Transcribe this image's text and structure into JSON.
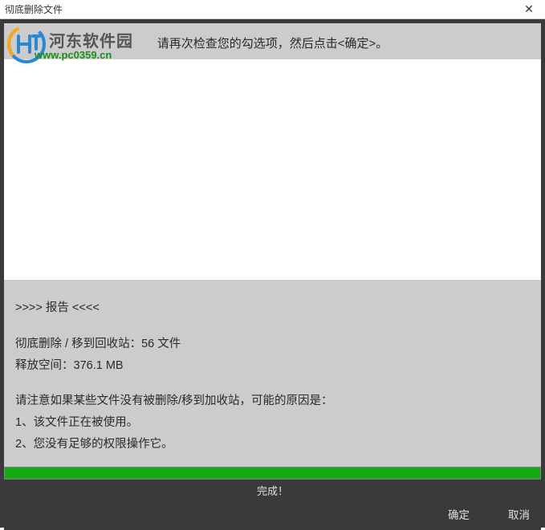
{
  "window": {
    "title": "彻底删除文件"
  },
  "watermark": {
    "brand": "河东软件园",
    "url": "www.pc0359.cn"
  },
  "header": {
    "instruction": "请再次检查您的勾选项，然后点击<确定>。"
  },
  "report": {
    "header": ">>>> 报告 <<<<",
    "deleted_line": "彻底删除 / 移到回收站：56 文件",
    "freed_line": "释放空间：376.1 MB",
    "notice_header": "请注意如果某些文件没有被删除/移到加收站，可能的原因是：",
    "reason1": "1、该文件正在被使用。",
    "reason2": "2、您没有足够的权限操作它。"
  },
  "progress": {
    "status": "完成！",
    "percent": 100
  },
  "buttons": {
    "ok": "确定",
    "cancel": "取消"
  },
  "colors": {
    "progress_bar": "#14a814",
    "dark_bg": "#3a3a3a",
    "panel_bg": "#cccccc"
  }
}
